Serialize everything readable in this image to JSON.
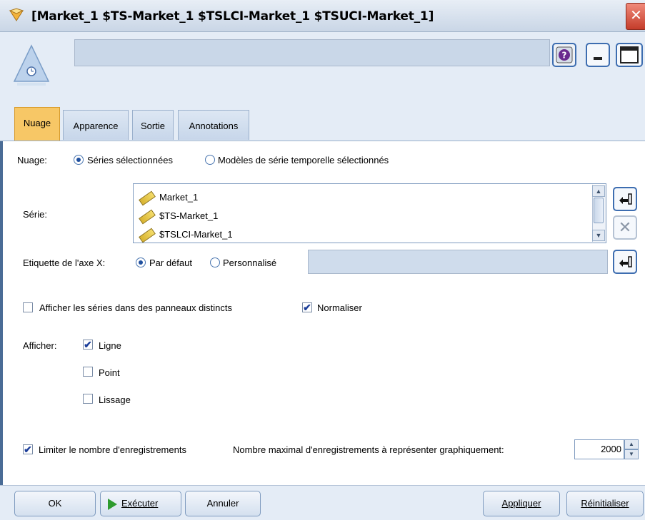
{
  "window": {
    "title": "[Market_1 $TS-Market_1 $TSLCI-Market_1 $TSUCI-Market_1]",
    "close_glyph": "✕",
    "help_glyph": "?",
    "minimize_glyph": "▁",
    "maximize_glyph": "☐",
    "node_name_value": ""
  },
  "tabs": [
    {
      "label": "Nuage",
      "active": true
    },
    {
      "label": "Apparence",
      "active": false
    },
    {
      "label": "Sortie",
      "active": false
    },
    {
      "label": "Annotations",
      "active": false
    }
  ],
  "form": {
    "nuage_label": "Nuage:",
    "nuage_options": [
      {
        "label": "Séries sélectionnées",
        "selected": true
      },
      {
        "label": "Modèles de série temporelle sélectionnés",
        "selected": false
      }
    ],
    "serie_label": "Série:",
    "series_items": [
      "Market_1",
      "$TS-Market_1",
      "$TSLCI-Market_1"
    ],
    "xaxis_label": "Etiquette de l'axe X:",
    "xaxis_options": [
      {
        "label": "Par défaut",
        "selected": true
      },
      {
        "label": "Personnalisé",
        "selected": false
      }
    ],
    "xaxis_custom_value": "",
    "separate_panels": {
      "label": "Afficher les séries dans des panneaux distincts",
      "checked": false
    },
    "normalize": {
      "label": "Normaliser",
      "checked": true
    },
    "display_label": "Afficher:",
    "display_options": [
      {
        "label": "Ligne",
        "checked": true
      },
      {
        "label": "Point",
        "checked": false
      },
      {
        "label": "Lissage",
        "checked": false
      }
    ],
    "limit_records": {
      "label": "Limiter le nombre d'enregistrements",
      "checked": true
    },
    "max_records_label": "Nombre maximal d'enregistrements à représenter graphiquement:",
    "max_records_value": "2000"
  },
  "buttons": {
    "ok": "OK",
    "run": "Exécuter",
    "cancel": "Annuler",
    "apply": "Appliquer",
    "reset": "Réinitialiser"
  },
  "colors": {
    "active_tab": "#f7c766",
    "accent_border": "#3d6db0",
    "check_mark": "#1c3e9a",
    "run_icon": "#2e9b2e"
  }
}
